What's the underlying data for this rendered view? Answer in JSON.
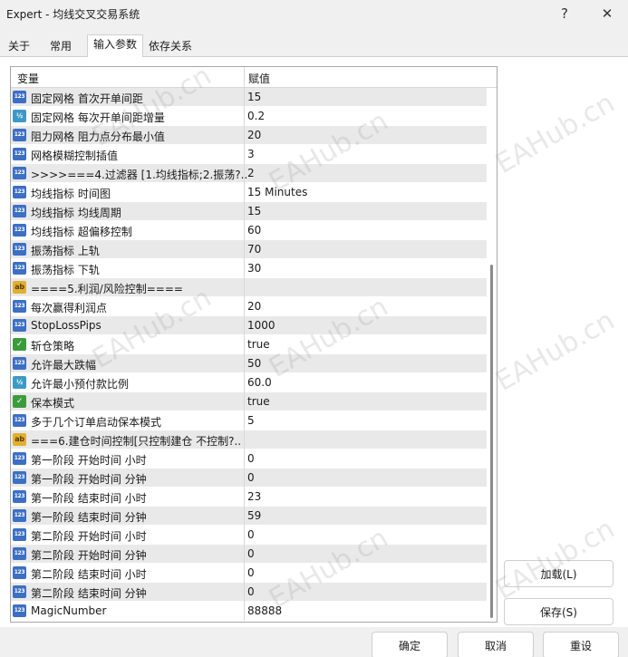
{
  "window": {
    "title": "Expert - 均线交叉交易系统",
    "help_glyph": "?",
    "close_glyph": "✕"
  },
  "tabs": [
    {
      "label": "关于",
      "active": false
    },
    {
      "label": "常用",
      "active": false
    },
    {
      "label": "输入参数",
      "active": true
    },
    {
      "label": "依存关系",
      "active": false
    }
  ],
  "grid": {
    "columns": {
      "variable": "变量",
      "value": "赋值"
    },
    "icon_labels": {
      "int": "123",
      "dbl": "½",
      "bool": "✓",
      "str": "ab"
    },
    "rows": [
      {
        "type": "int",
        "name": "固定网格 首次开单间距",
        "value": "15"
      },
      {
        "type": "dbl",
        "name": "固定网格 每次开单间距增量",
        "value": "0.2"
      },
      {
        "type": "int",
        "name": "阻力网格 阻力点分布最小值",
        "value": "20"
      },
      {
        "type": "int",
        "name": "网格模糊控制插值",
        "value": "3"
      },
      {
        "type": "int",
        "name": ">>>>===4.过滤器 [1.均线指标;2.振荡?..",
        "value": "2"
      },
      {
        "type": "int",
        "name": "均线指标 时间图",
        "value": "15 Minutes"
      },
      {
        "type": "int",
        "name": "均线指标 均线周期",
        "value": "15"
      },
      {
        "type": "int",
        "name": "均线指标 超偏移控制",
        "value": "60"
      },
      {
        "type": "int",
        "name": "振荡指标 上轨",
        "value": "70"
      },
      {
        "type": "int",
        "name": "振荡指标 下轨",
        "value": "30"
      },
      {
        "type": "str",
        "name": "====5.利润/风险控制====",
        "value": ""
      },
      {
        "type": "int",
        "name": "每次赢得利润点",
        "value": "20"
      },
      {
        "type": "int",
        "name": "StopLossPips",
        "value": "1000"
      },
      {
        "type": "bool",
        "name": "斩仓策略",
        "value": "true"
      },
      {
        "type": "int",
        "name": "允许最大跌幅",
        "value": "50"
      },
      {
        "type": "dbl",
        "name": "允许最小预付款比例",
        "value": "60.0"
      },
      {
        "type": "bool",
        "name": "保本模式",
        "value": "true"
      },
      {
        "type": "int",
        "name": "多于几个订单启动保本模式",
        "value": "5"
      },
      {
        "type": "str",
        "name": "===6.建仓时间控制[只控制建仓 不控制?..",
        "value": ""
      },
      {
        "type": "int",
        "name": "第一阶段 开始时间 小时",
        "value": "0"
      },
      {
        "type": "int",
        "name": "第一阶段 开始时间 分钟",
        "value": "0"
      },
      {
        "type": "int",
        "name": "第一阶段 结束时间 小时",
        "value": "23"
      },
      {
        "type": "int",
        "name": "第一阶段 结束时间 分钟",
        "value": "59"
      },
      {
        "type": "int",
        "name": "第二阶段 开始时间 小时",
        "value": "0"
      },
      {
        "type": "int",
        "name": "第二阶段 开始时间 分钟",
        "value": "0"
      },
      {
        "type": "int",
        "name": "第二阶段 结束时间 小时",
        "value": "0"
      },
      {
        "type": "int",
        "name": "第二阶段 结束时间 分钟",
        "value": "0"
      },
      {
        "type": "int",
        "name": "MagicNumber",
        "value": "88888"
      }
    ]
  },
  "buttons": {
    "load": "加载(L)",
    "save": "保存(S)",
    "ok": "确定",
    "cancel": "取消",
    "reset": "重设"
  },
  "watermark": "EAHub.cn"
}
